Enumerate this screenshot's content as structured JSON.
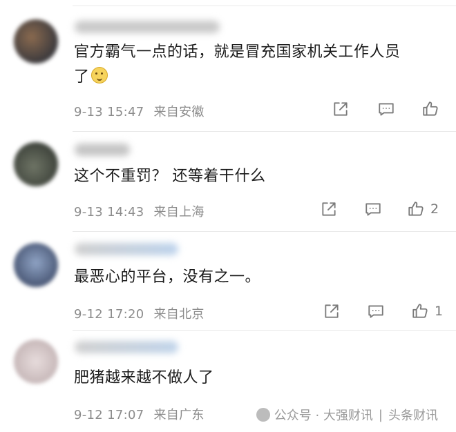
{
  "comments": [
    {
      "text_line1": "官方霸气一点的话，就是冒充国家机关工作人员",
      "text_line2": "了",
      "emoji": "smirk-emoji",
      "date": "9-13 15:47",
      "location": "来自安徽",
      "likes": ""
    },
    {
      "text_line1": "这个不重罚？ 还等着干什么",
      "date": "9-13 14:43",
      "location": "来自上海",
      "likes": "2"
    },
    {
      "text_line1": "最恶心的平台，没有之一。",
      "date": "9-12 17:20",
      "location": "来自北京",
      "likes": "1"
    },
    {
      "text_line1": "肥猪越来越不做人了",
      "date": "9-12 17:07",
      "location": "来自广东",
      "likes": ""
    }
  ],
  "icons": {
    "share": "share-icon",
    "reply": "comment-icon",
    "like": "thumbs-up-icon"
  },
  "watermark": {
    "left": "公众号 · 大强财讯",
    "right": "头条财讯"
  }
}
